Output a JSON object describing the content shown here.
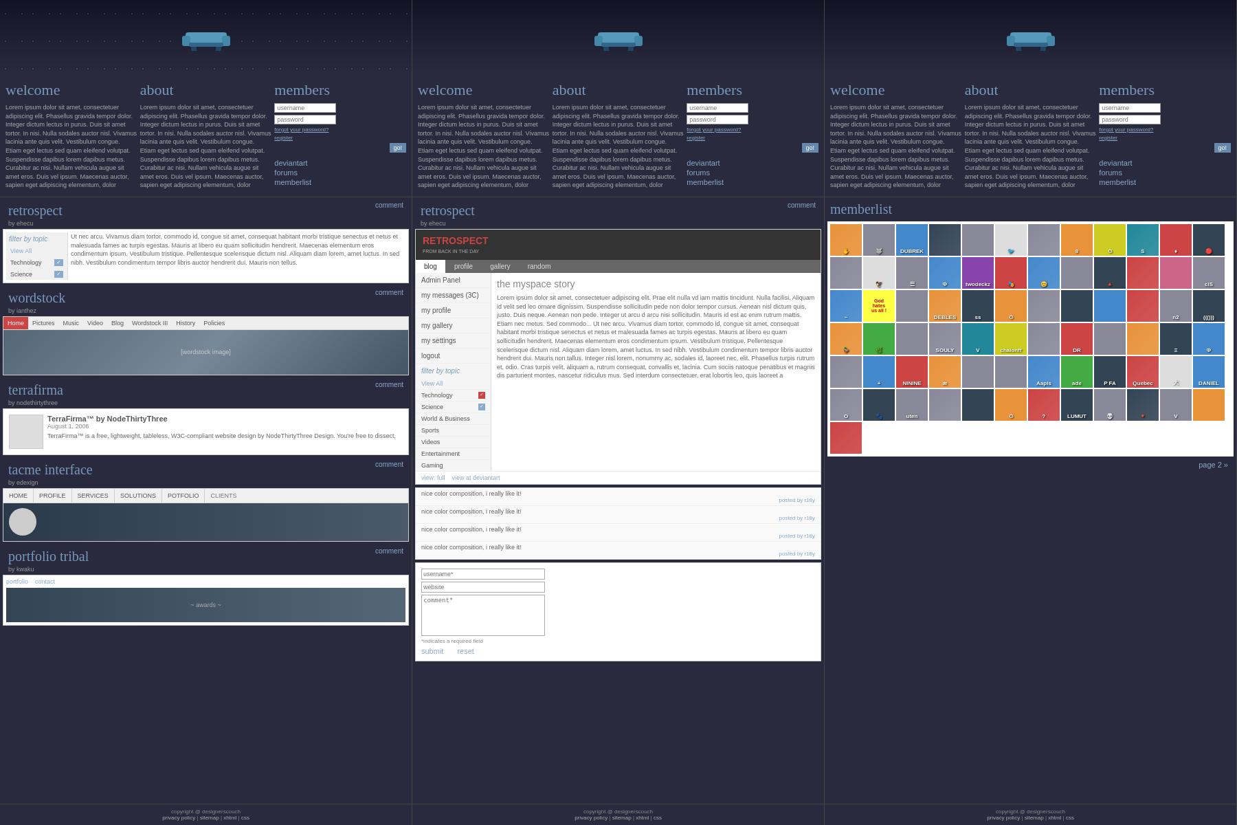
{
  "panels": [
    {
      "id": "panel-1",
      "header": {
        "sofa": "sofa decoration"
      },
      "nav": {
        "welcome_title": "welcome",
        "about_title": "about",
        "members_title": "members",
        "welcome_text": "Lorem ipsum dolor sit amet, consectetuer adipiscing elit. Phasellus gravida tempor dolor. Integer dictum lectus in purus. Duis sit amet tortor. In nisi. Nulla sodales auctor nisl. Vivamus lacinia ante quis velit. Vestibulum congue. Etiam eget lectus sed quam eleifend volutpat. Suspendisse dapibus lorem dapibus metus. Curabitur ac nisi. Nullam vehicula augue sit amet eros. Duis vel ipsum. Maecenas auctor, sapien eget adipiscing elementum, dolor",
        "about_text": "Lorem ipsum dolor sit amet, consectetuer adipiscing elit. Phasellus gravida tempor dolor. Integer dictum lectus in purus. Duis sit amet tortor. In nisi. Nulla sodales auctor nisl. Vivamus lacinia ante quis velit. Vestibulum congue. Etiam eget lectus sed quam eleifend volutpat. Suspendisse dapibus lorem dapibus metus. Curabitur ac nisi. Nullam vehicula augue sit amet eros. Duis vel ipsum. Maecenas auctor, sapien eget adipiscing elementum, dolor",
        "username_placeholder": "username",
        "password_placeholder": "password",
        "forgot_password": "forgot your password?",
        "register": "register",
        "go_label": "go!",
        "nav_links": [
          "deviantart",
          "forums",
          "memberlist"
        ]
      },
      "sections": [
        {
          "type": "retrospect",
          "title": "retrospect",
          "author": "by ehecu",
          "comment_label": "comment",
          "filter_title": "filter by topic",
          "filter_items": [
            "View All",
            "Technology",
            "Science"
          ],
          "text": "Ut nec arcu. Vivamus diam tortor, commodo id, congue sit amet, consequat habitant morbi tristique senectus et netus et malesuada fames ac turpis egestas. Mauris at libero eu quam sollicitudin hendrerit. Maecenas elementum eros condimentum ipsum. Vestibulum tristique. Pellentesque scelerisque dictum nisl. Aliquam diam lorem, amet luctus. In sed nibh. Vestibulum condimentum tempor libris auctor hendrerit dui. Mauris non tellus."
        },
        {
          "type": "wordstock",
          "title": "wordstock",
          "author": "by ianthez",
          "comment_label": "comment",
          "nav_items": [
            "Home",
            "Pictures",
            "Music",
            "Video",
            "Blog",
            "Wordstock III",
            "History",
            "Policies"
          ]
        },
        {
          "type": "terrafirma",
          "title": "terrafirma",
          "author": "by nodethirtythree",
          "comment_label": "comment",
          "tf_title": "TerraFirma™ by NodeThirtyThree",
          "tf_date": "August 1, 2006",
          "tf_body": "TerraFirma™ is a free, lightweight, tableless, W3C-compliant website design by NodeThirtyThree Design. You're free to dissect,"
        },
        {
          "type": "tacme",
          "title": "tacme interface",
          "author": "by edexign",
          "comment_label": "comment",
          "nav_items": [
            "HOME",
            "PROFILE",
            "SERVICES",
            "SOLUTIONS",
            "POTFOLIO",
            "CLIENTS"
          ]
        },
        {
          "type": "portfolio",
          "title": "portfolio tribal",
          "author": "by kwaku",
          "comment_label": "comment",
          "nav_items": [
            "portfolio",
            "contact"
          ]
        }
      ],
      "footer": {
        "copyright": "copyright @ designerscouch",
        "links": [
          "privacy policy",
          "sitemap",
          "xhtml",
          "css"
        ]
      }
    },
    {
      "id": "panel-2",
      "header": {
        "sofa": "sofa decoration"
      },
      "nav": {
        "welcome_title": "welcome",
        "about_title": "about",
        "members_title": "members",
        "welcome_text": "Lorem ipsum dolor sit amet, consectetuer adipiscing elit. Phasellus gravida tempor dolor. Integer dictum lectus in purus. Duis sit amet tortor. In nisi. Nulla sodales auctor nisl. Vivamus lacinia ante quis velit. Vestibulum congue. Etiam eget lectus sed quam eleifend volutpat. Suspendisse dapibus lorem dapibus metus. Curabitur ac nisi. Nullam vehicula augue sit amet eros. Duis vel ipsum. Maecenas auctor, sapien eget adipiscing elementum, dolor",
        "about_text": "Lorem ipsum dolor sit amet, consectetuer adipiscing elit. Phasellus gravida tempor dolor. Integer dictum lectus in purus. Duis sit amet tortor. In nisi. Nulla sodales auctor nisl. Vivamus lacinia ante quis velit. Vestibulum congue. Etiam eget lectus sed quam eleifend volutpat. Suspendisse dapibus lorem dapibus metus. Curabitur ac nisi. Nullam vehicula augue sit amet eros. Duis vel ipsum. Maecenas auctor, sapien eget adipiscing elementum, dolor",
        "username_placeholder": "username",
        "password_placeholder": "password",
        "forgot_password": "forgot your password?",
        "register": "register",
        "go_label": "go!",
        "nav_links": [
          "deviantart",
          "forums",
          "memberlist"
        ]
      },
      "sections": [
        {
          "type": "retrospect-full",
          "title": "retrospect",
          "author": "by ehecu",
          "comment_label": "comment",
          "retro_brand": "RETROSPECT",
          "retro_subtitle": "FROM BACK IN THE DAY",
          "tabs": [
            "blog",
            "profile",
            "gallery",
            "random"
          ],
          "sidebar_items": [
            "Admin Panel",
            "my messages (3C)",
            "my profile",
            "my gallery",
            "my settings",
            "logout"
          ],
          "filter_title": "filter by topic",
          "filter_items": [
            "View All",
            "Technology",
            "Science",
            "World & Business",
            "Sports",
            "Videos",
            "Entertainment",
            "Gaming"
          ],
          "story_title": "the myspace story",
          "story_text": "Lorem ipsum dolor sit amet, consectetuer adipiscing elit. Prae elit nulla vd iam mattis tincidunt. Nulla facilisi. Aliquam id velit sed leo ornare dignissim. Suspendisse sollicitudin pede non dolor tempor cursus. Aenean nisl dictum quis, justo. Duis neque. Aenean non pede. Integer ut arcu d arcu nisi sollicitudin. Mauris id est ac enim rutrum mattis. Etiam nec metus. Sed commodo...\n\nUt nec arcu. Vivamus diam tortor, commodo id, congue sit amet, consequat habitant morbi tristique senectus et netus et malesuada fames ac turpis egestas. Mauris at libero eu quam sollicitudin hendrerit. Maecenas elementum eros condimentum ipsum. Vestibulum tristique. Pellentesque scelerisque dictum nisl. Aliquam diam lorem, amet luctus. In sed nibh. Vestibulum condimentum tempor libris auctor hendrerit dui. Mauris non tallus.\n\nInteger nisl lorem, nonummy ac, sodales id, laoreet nec, elit. Phasellus turpis rutrum et, odio. Cras turpis velit, aliquam a, rutrum consequat, convallis et, lacinia. Cum sociis natoque penatibus et magnis dis parturient montes, nascetur ridiculus mus. Sed interdum consectetuer, erat lobortis leo, quis laoreet a",
          "view_links": [
            "view: full",
            "view at deviantart"
          ],
          "comment_entries": [
            {
              "text": "nice color composition, i really like it!",
              "poster": "posted by r18y"
            },
            {
              "text": "nice color composition, i really like it!",
              "poster": "posted by r18y"
            },
            {
              "text": "nice color composition, i really like it!",
              "poster": "posted by r18y"
            },
            {
              "text": "nice color composition, i really like it!",
              "poster": "posted by r18y"
            }
          ],
          "form": {
            "username_label": "username*",
            "website_label": "website",
            "comment_label": "comment*",
            "note": "*indicates a required field",
            "submit_label": "submit",
            "reset_label": "reset"
          }
        }
      ],
      "footer": {
        "copyright": "copyright @ designerscouch",
        "links": [
          "privacy policy",
          "sitemap",
          "xhtml",
          "css"
        ]
      }
    },
    {
      "id": "panel-3",
      "header": {
        "sofa": "sofa decoration"
      },
      "nav": {
        "welcome_title": "welcome",
        "about_title": "about",
        "members_title": "members",
        "welcome_text": "Lorem ipsum dolor sit amet, consectetuer adipiscing elit. Phasellus gravida tempor dolor. Integer dictum lectus in purus. Duis sit amet tortor. In nisi. Nulla sodales auctor nisl. Vivamus lacinia ante quis velit. Vestibulum congue. Etiam eget lectus sed quam eleifend volutpat. Suspendisse dapibus lorem dapibus metus. Curabitur ac nisi. Nullam vehicula augue sit amet eros. Duis vel ipsum. Maecenas auctor, sapien eget adipiscing elementum, dolor",
        "about_text": "Lorem ipsum dolor sit amet, consectetuer adipiscing elit. Phasellus gravida tempor dolor. Integer dictum lectus in purus. Duis sit amet tortor. In nisi. Nulla sodales auctor nisl. Vivamus lacinia ante quis velit. Vestibulum congue. Etiam eget lectus sed quam eleifend volutpat. Suspendisse dapibus lorem dapibus metus. Curabitur ac nisi. Nullam vehicula augue sit amet eros. Duis vel ipsum. Maecenas auctor, sapien eget adipiscing elementum, dolor",
        "username_placeholder": "username",
        "password_placeholder": "password",
        "forgot_password": "forgot your password?",
        "register": "register",
        "go_label": "go!",
        "nav_links": [
          "deviantart",
          "forums",
          "memberlist"
        ]
      },
      "memberlist_title": "memberlist",
      "memberlist_avatars": [
        {
          "color": "av-orange",
          "text": "✋"
        },
        {
          "color": "av-gray",
          "text": "🐺"
        },
        {
          "color": "av-blue",
          "text": "DUBREK"
        },
        {
          "color": "av-dark",
          "text": ""
        },
        {
          "color": "av-gray",
          "text": ""
        },
        {
          "color": "av-white",
          "text": "🐦"
        },
        {
          "color": "av-gray",
          "text": ""
        },
        {
          "color": "av-orange",
          "text": "8"
        },
        {
          "color": "av-yellow",
          "text": "⊙"
        },
        {
          "color": "av-teal",
          "text": "S"
        },
        {
          "color": "av-red",
          "text": "♦"
        },
        {
          "color": "av-dark",
          "text": "🔴"
        },
        {
          "color": "av-gray",
          "text": ""
        },
        {
          "color": "av-white",
          "text": "🦅"
        },
        {
          "color": "av-gray",
          "text": "☰"
        },
        {
          "color": "av-blue",
          "text": "Ф"
        },
        {
          "color": "av-purple",
          "text": "twodeckz"
        },
        {
          "color": "av-red",
          "text": "🎭"
        },
        {
          "color": "av-blue",
          "text": "😊"
        },
        {
          "color": "av-gray",
          "text": ""
        },
        {
          "color": "av-dark",
          "text": "🔺"
        },
        {
          "color": "av-red",
          "text": ""
        },
        {
          "color": "av-pink",
          "text": ""
        },
        {
          "color": "av-gray",
          "text": "ciS"
        },
        {
          "color": "av-blue",
          "text": "~"
        },
        {
          "color": "av-yellow",
          "text": "God hates us all!",
          "special": "god-hates"
        },
        {
          "color": "av-gray",
          "text": ""
        },
        {
          "color": "av-orange",
          "text": "DEBLES"
        },
        {
          "color": "av-dark",
          "text": "ss"
        },
        {
          "color": "av-orange",
          "text": "⊙"
        },
        {
          "color": "av-gray",
          "text": ""
        },
        {
          "color": "av-dark",
          "text": ""
        },
        {
          "color": "av-blue",
          "text": ""
        },
        {
          "color": "av-red",
          "text": ""
        },
        {
          "color": "av-gray",
          "text": "n2"
        },
        {
          "color": "av-dark",
          "text": "((()))"
        },
        {
          "color": "av-orange",
          "text": "🦆"
        },
        {
          "color": "av-green",
          "text": "🌿"
        },
        {
          "color": "av-gray",
          "text": ""
        },
        {
          "color": "av-gray",
          "text": "SOULY"
        },
        {
          "color": "av-teal",
          "text": "V"
        },
        {
          "color": "av-yellow",
          "text": "chalonff"
        },
        {
          "color": "av-gray",
          "text": ""
        },
        {
          "color": "av-red",
          "text": "DR"
        },
        {
          "color": "av-gray",
          "text": ""
        },
        {
          "color": "av-orange",
          "text": ""
        },
        {
          "color": "av-dark",
          "text": "Ξ"
        },
        {
          "color": "av-blue",
          "text": "Ф"
        },
        {
          "color": "av-gray",
          "text": ""
        },
        {
          "color": "av-blue",
          "text": "+"
        },
        {
          "color": "av-red",
          "text": "NININE"
        },
        {
          "color": "av-orange",
          "text": "æ"
        },
        {
          "color": "av-gray",
          "text": ""
        },
        {
          "color": "av-gray",
          "text": ""
        },
        {
          "color": "av-blue",
          "text": "Aapis"
        },
        {
          "color": "av-green",
          "text": "ade"
        },
        {
          "color": "av-dark",
          "text": "P FA"
        },
        {
          "color": "av-red",
          "text": "Quebec"
        },
        {
          "color": "av-white",
          "text": "大"
        },
        {
          "color": "av-blue",
          "text": "DANIEL"
        },
        {
          "color": "av-gray",
          "text": "O"
        },
        {
          "color": "av-dark",
          "text": "🐾"
        },
        {
          "color": "av-gray",
          "text": "uten"
        },
        {
          "color": "av-gray",
          "text": ""
        },
        {
          "color": "av-dark",
          "text": ""
        },
        {
          "color": "av-orange",
          "text": "⊙"
        },
        {
          "color": "av-red",
          "text": "?"
        },
        {
          "color": "av-dark",
          "text": "LUMUT"
        },
        {
          "color": "av-gray",
          "text": "💀"
        },
        {
          "color": "av-dark",
          "text": "🔻"
        },
        {
          "color": "av-gray",
          "text": "V"
        },
        {
          "color": "av-orange",
          "text": ""
        },
        {
          "color": "av-red",
          "text": ""
        }
      ],
      "page_next": "page 2 »",
      "footer": {
        "copyright": "copyright @ designerscouch",
        "links": [
          "privacy policy",
          "sitemap",
          "xhtml",
          "css"
        ]
      }
    }
  ]
}
